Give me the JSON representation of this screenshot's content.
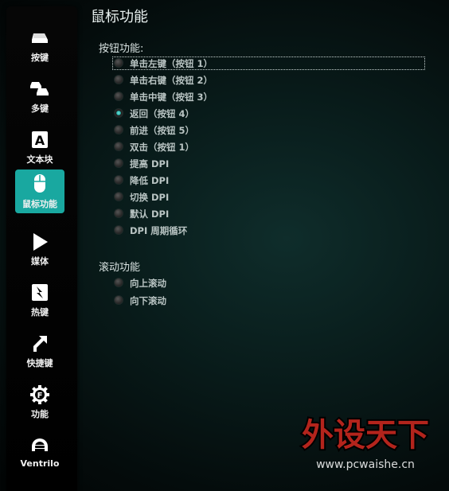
{
  "sidebar": {
    "items": [
      {
        "label": "按键",
        "icon": "key-icon"
      },
      {
        "label": "多键",
        "icon": "multi-key-icon"
      },
      {
        "label": "文本块",
        "icon": "text-block-icon"
      },
      {
        "label": "鼠标功能",
        "icon": "mouse-icon",
        "active": true
      },
      {
        "label": "媒体",
        "icon": "play-icon"
      },
      {
        "label": "热键",
        "icon": "hotkey-icon"
      },
      {
        "label": "快捷键",
        "icon": "shortcut-arrow-icon"
      },
      {
        "label": "功能",
        "icon": "function-gear-icon"
      },
      {
        "label": "Ventrilo",
        "icon": "headset-icon"
      }
    ]
  },
  "main": {
    "title": "鼠标功能",
    "button_section": {
      "title": "按钮功能:",
      "options": [
        "单击左键（按钮 1）",
        "单击右键（按钮 2）",
        "单击中键（按钮 3）",
        "返回（按钮 4）",
        "前进（按钮 5）",
        "双击（按钮 1）",
        "提高 DPI",
        "降低 DPI",
        "切换 DPI",
        "默认 DPI",
        "DPI 周期循环"
      ],
      "selected_index": 3,
      "focused_index": 0
    },
    "scroll_section": {
      "title": "滚动功能",
      "options": [
        "向上滚动",
        "向下滚动"
      ]
    }
  },
  "watermark": {
    "text": "外设天下",
    "url": "www.pcwaishe.cn"
  },
  "colors": {
    "accent": "#19a8a0",
    "radio_checked": "#2bb4ab",
    "watermark_red": "#b3241c"
  }
}
